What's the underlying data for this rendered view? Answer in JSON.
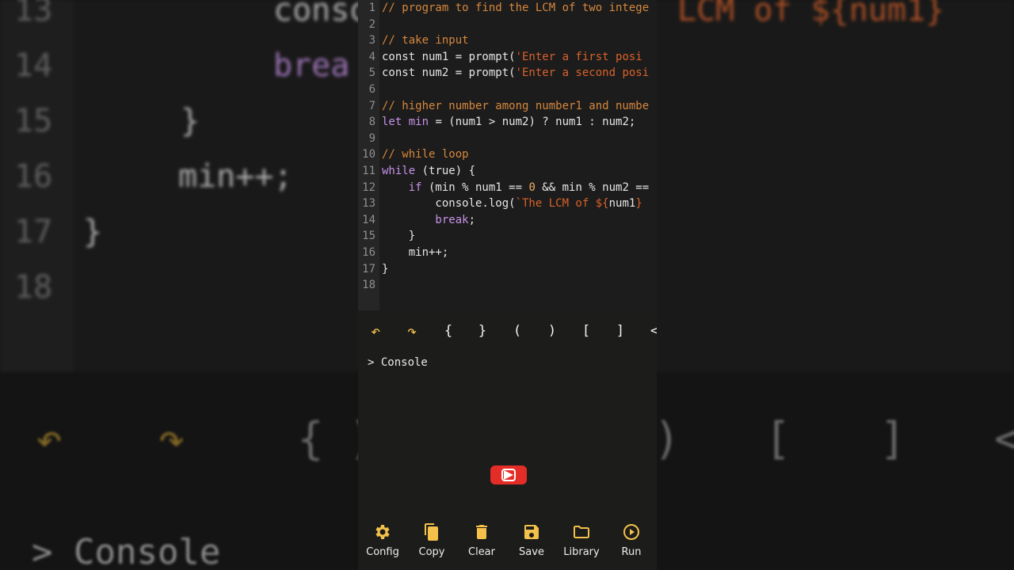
{
  "editor": {
    "lines": [
      {
        "n": "1",
        "segs": [
          {
            "t": "// program to find the LCM of two intege",
            "c": "c-com"
          }
        ]
      },
      {
        "n": "2",
        "segs": []
      },
      {
        "n": "3",
        "segs": [
          {
            "t": "// take input",
            "c": "c-com"
          }
        ]
      },
      {
        "n": "4",
        "segs": [
          {
            "t": "const num1 = prompt(",
            "c": ""
          },
          {
            "t": "'Enter a first posi",
            "c": "c-str"
          }
        ]
      },
      {
        "n": "5",
        "segs": [
          {
            "t": "const num2 = prompt(",
            "c": ""
          },
          {
            "t": "'Enter a second posi",
            "c": "c-str"
          }
        ]
      },
      {
        "n": "6",
        "segs": []
      },
      {
        "n": "7",
        "segs": [
          {
            "t": "// higher number among number1 and numbe",
            "c": "c-com"
          }
        ]
      },
      {
        "n": "8",
        "segs": [
          {
            "t": "let ",
            "c": "c-kw"
          },
          {
            "t": "min",
            "c": "c-var"
          },
          {
            "t": " = (num1 > num2) ? num1 : num2;",
            "c": ""
          }
        ]
      },
      {
        "n": "9",
        "segs": []
      },
      {
        "n": "10",
        "segs": [
          {
            "t": "// while loop",
            "c": "c-com"
          }
        ]
      },
      {
        "n": "11",
        "segs": [
          {
            "t": "while",
            "c": "c-kw"
          },
          {
            "t": " (true) {",
            "c": ""
          }
        ]
      },
      {
        "n": "12",
        "segs": [
          {
            "t": "    if",
            "c": "c-kw"
          },
          {
            "t": " (min % num1 == ",
            "c": ""
          },
          {
            "t": "0",
            "c": "c-num"
          },
          {
            "t": " && min % num2 ==",
            "c": ""
          }
        ]
      },
      {
        "n": "13",
        "segs": [
          {
            "t": "        console.log(",
            "c": ""
          },
          {
            "t": "`The LCM of ${",
            "c": "c-tpl"
          },
          {
            "t": "num1",
            "c": ""
          },
          {
            "t": "}",
            "c": "c-tpl"
          }
        ]
      },
      {
        "n": "14",
        "segs": [
          {
            "t": "        break",
            "c": "c-kw"
          },
          {
            "t": ";",
            "c": ""
          }
        ]
      },
      {
        "n": "15",
        "segs": [
          {
            "t": "    }",
            "c": ""
          }
        ]
      },
      {
        "n": "16",
        "segs": [
          {
            "t": "    min++;",
            "c": ""
          }
        ]
      },
      {
        "n": "17",
        "segs": [
          {
            "t": "}",
            "c": ""
          }
        ]
      },
      {
        "n": "18",
        "segs": []
      }
    ]
  },
  "toolbar": {
    "undo": "↶",
    "redo": "↷",
    "keys": [
      "{",
      "}",
      "(",
      ")",
      "[",
      "]",
      "<"
    ]
  },
  "console": {
    "label": "> Console"
  },
  "bottom_bar": {
    "items": [
      {
        "label": "Config",
        "icon": "gear-icon"
      },
      {
        "label": "Copy",
        "icon": "copy-icon"
      },
      {
        "label": "Clear",
        "icon": "trash-icon"
      },
      {
        "label": "Save",
        "icon": "save-icon"
      },
      {
        "label": "Library",
        "icon": "folder-icon"
      },
      {
        "label": "Run",
        "icon": "play-circle-icon"
      }
    ]
  },
  "background": {
    "nums": [
      "13",
      "14",
      "15",
      "16",
      "17",
      "18"
    ],
    "code_lines": [
      {
        "t": "conso",
        "c": ""
      },
      {
        "t": "brea",
        "c": "kw"
      },
      {
        "t": "}",
        "c": ""
      },
      {
        "t": "min++;",
        "c": ""
      },
      {
        "t": "}",
        "c": ""
      }
    ],
    "right_text": "LCM of ${num1}",
    "tools": [
      "↶",
      "↷",
      "{",
      ")",
      ")",
      "[",
      "]",
      "<"
    ],
    "console": "> Console"
  },
  "colors": {
    "accent": "#f4c14a",
    "comment": "#d6873d",
    "keyword": "#c792ea",
    "string": "#d9622b",
    "youtube": "#e52d27"
  }
}
